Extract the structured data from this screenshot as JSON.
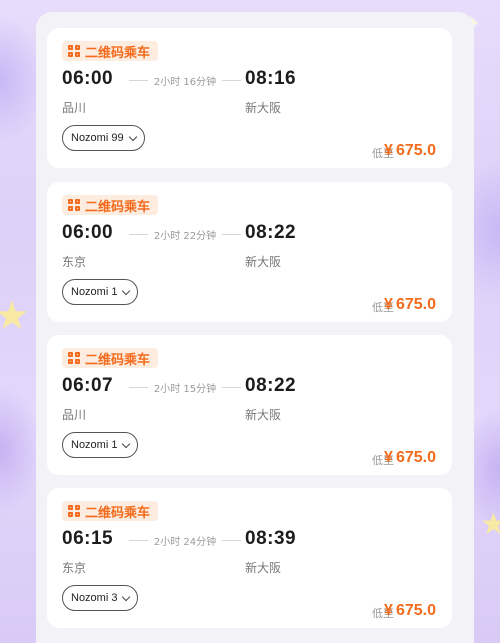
{
  "badge_label": "二维码乘车",
  "price_prefix": "低至",
  "currency": "¥",
  "colors": {
    "accent": "#f36b1c",
    "badge_bg": "#fdece0",
    "card_bg": "#ffffff",
    "panel_bg": "#f3f2f7"
  },
  "trains": [
    {
      "dep_time": "06:00",
      "duration": "2小时 16分钟",
      "arr_time": "08:16",
      "dep_station": "品川",
      "arr_station": "新大阪",
      "train": "Nozomi 99",
      "price": "675.0"
    },
    {
      "dep_time": "06:00",
      "duration": "2小时 22分钟",
      "arr_time": "08:22",
      "dep_station": "东京",
      "arr_station": "新大阪",
      "train": "Nozomi 1",
      "price": "675.0"
    },
    {
      "dep_time": "06:07",
      "duration": "2小时 15分钟",
      "arr_time": "08:22",
      "dep_station": "品川",
      "arr_station": "新大阪",
      "train": "Nozomi 1",
      "price": "675.0"
    },
    {
      "dep_time": "06:15",
      "duration": "2小时 24分钟",
      "arr_time": "08:39",
      "dep_station": "东京",
      "arr_station": "新大阪",
      "train": "Nozomi 3",
      "price": "675.0"
    }
  ]
}
